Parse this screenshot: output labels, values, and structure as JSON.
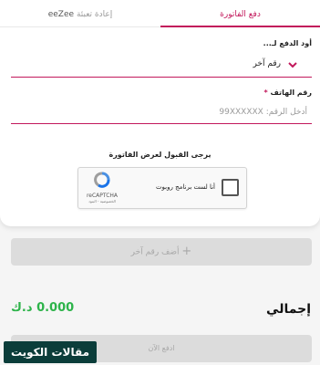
{
  "tabs": {
    "pay_bill": "دفع الفاتورة",
    "recharge": "إعادة تعبئة",
    "recharge_brand": "eeZee"
  },
  "form": {
    "pay_for_label": "أود الدفع لـ...",
    "pay_for_value": "رقم آخر",
    "phone_label": "رقم الهاتف",
    "required_mark": "*",
    "phone_placeholder": "أدخل الرقم: 99XXXXXX"
  },
  "captcha": {
    "title": "يرجى القبول لعرض الفاتورة",
    "checkbox_text": "أنا لست برنامج روبوت",
    "brand": "reCAPTCHA",
    "terms": "الخصوصية - البنود"
  },
  "actions": {
    "add_number_label": "أضف رقم آخر",
    "add_icon": "+",
    "pay_now_label": "ادفع الآن"
  },
  "summary": {
    "total_label": "إجمالي",
    "total_amount": "0.000 د.ك"
  },
  "watermark": {
    "text": "مقالات الكويت"
  },
  "colors": {
    "accent": "#c2185b",
    "amount": "#2db34a",
    "disabled": "#dcdcdc"
  }
}
